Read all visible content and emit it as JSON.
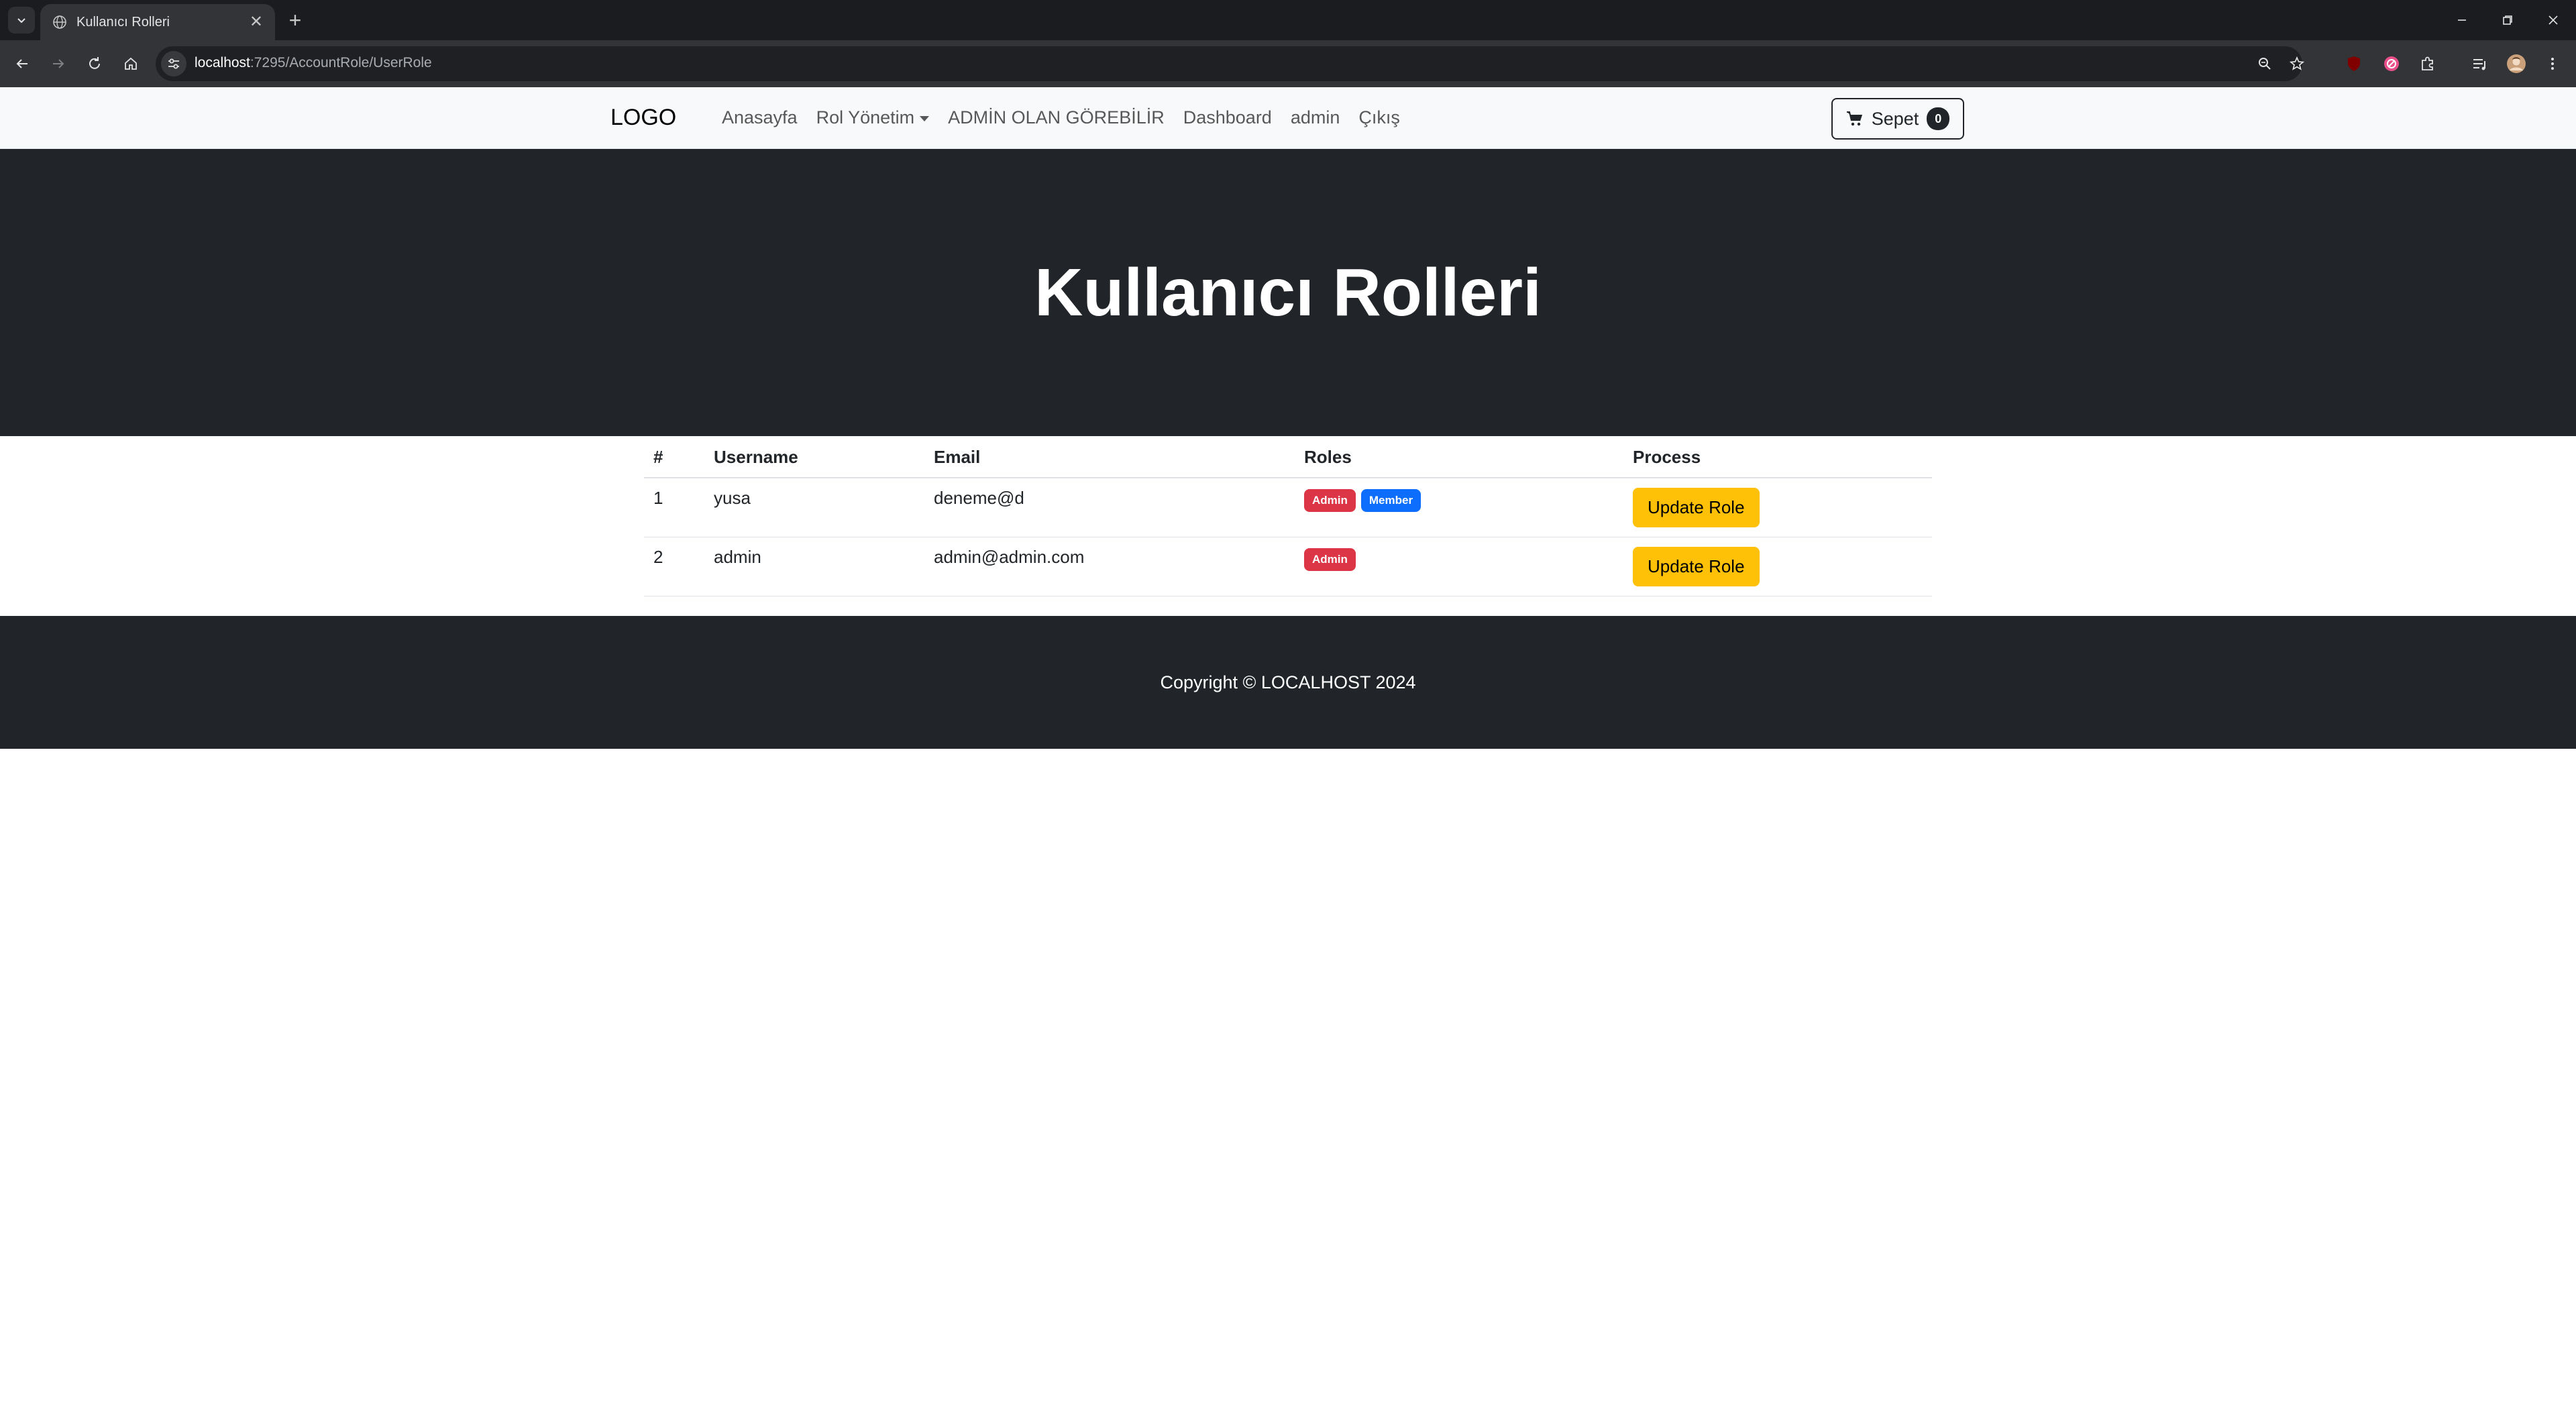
{
  "browser": {
    "tab_title": "Kullanıcı Rolleri",
    "new_tab_label": "+",
    "url_host": "localhost",
    "url_path": ":7295/AccountRole/UserRole"
  },
  "navbar": {
    "brand": "LOGO",
    "links": [
      {
        "label": "Anasayfa"
      },
      {
        "label": "Rol Yönetim"
      },
      {
        "label": "ADMİN OLAN GÖREBİLİR"
      },
      {
        "label": "Dashboard"
      },
      {
        "label": "admin"
      },
      {
        "label": "Çıkış"
      }
    ],
    "cart_label": "Sepet",
    "cart_count": "0"
  },
  "hero": {
    "title": "Kullanıcı Rolleri"
  },
  "table": {
    "headers": [
      "#",
      "Username",
      "Email",
      "Roles",
      "Process"
    ],
    "rows": [
      {
        "index": "1",
        "username": "yusa",
        "email": "deneme@d",
        "roles": [
          {
            "label": "Admin",
            "color": "#dc3545"
          },
          {
            "label": "Member",
            "color": "#0d6efd"
          }
        ],
        "action_label": "Update Role"
      },
      {
        "index": "2",
        "username": "admin",
        "email": "admin@admin.com",
        "roles": [
          {
            "label": "Admin",
            "color": "#dc3545"
          }
        ],
        "action_label": "Update Role"
      }
    ]
  },
  "footer": {
    "copyright": "Copyright © LOCALHOST 2024"
  },
  "colors": {
    "hero_bg": "#212529",
    "admin_badge": "#dc3545",
    "member_badge": "#0d6efd",
    "warning_button": "#ffc107"
  }
}
